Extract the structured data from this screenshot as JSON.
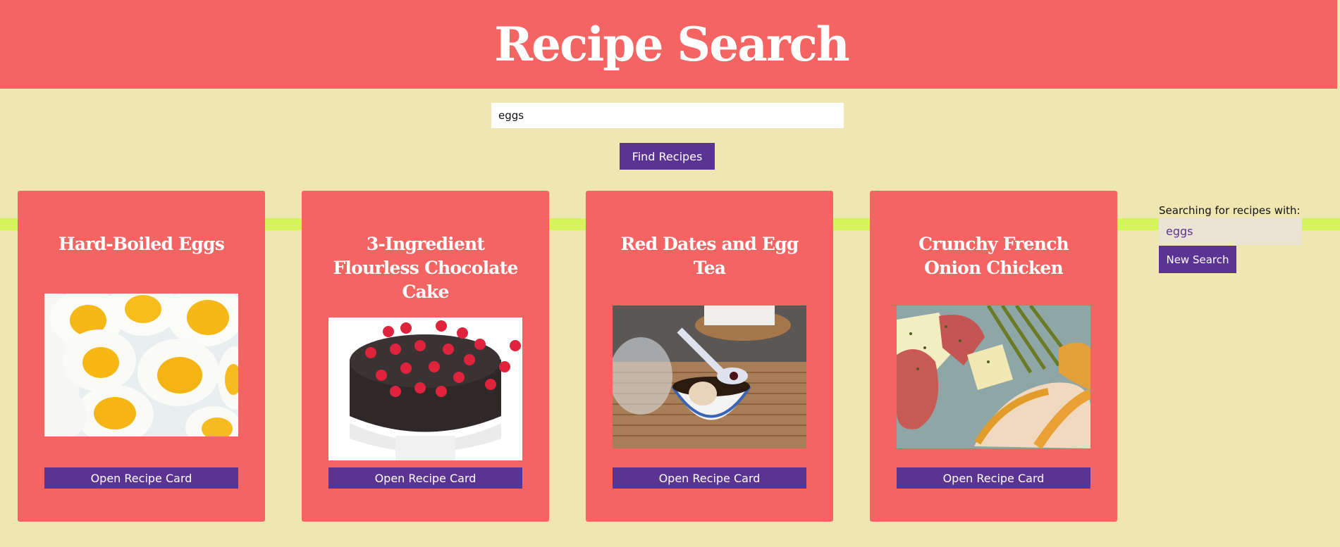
{
  "header": {
    "title": "Recipe Search"
  },
  "search": {
    "value": "eggs",
    "button_label": "Find Recipes"
  },
  "colors": {
    "header_bg": "#f46462",
    "page_bg": "#f0e6b2",
    "card_bg": "#f46462",
    "button_bg": "#5b3393",
    "connector": "#d4f55a"
  },
  "cards": [
    {
      "title": "Hard-Boiled Eggs",
      "button_label": "Open Recipe Card",
      "image": "hard-boiled-eggs-photo"
    },
    {
      "title": "3-Ingredient Flourless Chocolate Cake",
      "button_label": "Open Recipe Card",
      "image": "chocolate-cake-photo"
    },
    {
      "title": "Red Dates and Egg Tea",
      "button_label": "Open Recipe Card",
      "image": "egg-tea-photo"
    },
    {
      "title": "Crunchy French Onion Chicken",
      "button_label": "Open Recipe Card",
      "image": "french-onion-chicken-photo"
    }
  ],
  "sidebar": {
    "label": "Searching for recipes with:",
    "term": "eggs",
    "button_label": "New Search"
  }
}
